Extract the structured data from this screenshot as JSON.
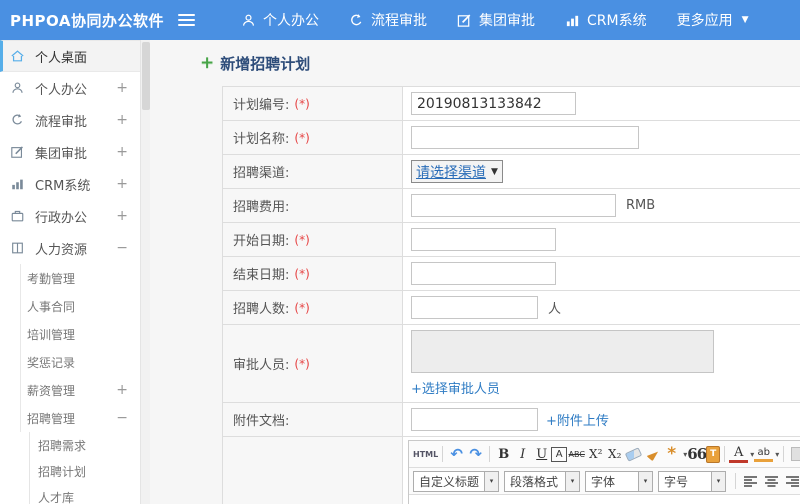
{
  "app": {
    "logo": "PHPOA协同办公软件"
  },
  "colors": {
    "navbar": "#4a90e2",
    "active_accent": "#56aee9",
    "title": "#2e4d7a",
    "plus_green": "#47a447",
    "link": "#2f7cc4",
    "required": "#e64545"
  },
  "navbar": {
    "items": [
      {
        "label": "个人办公",
        "icon": "user-icon"
      },
      {
        "label": "流程审批",
        "icon": "workflow-icon"
      },
      {
        "label": "集团审批",
        "icon": "edit-icon"
      },
      {
        "label": "CRM系统",
        "icon": "chart-icon"
      },
      {
        "label": "更多应用",
        "icon": "caret-down-icon",
        "caret": "▼"
      }
    ]
  },
  "sidebar": {
    "items": [
      {
        "label": "个人桌面",
        "icon": "home-icon",
        "expander": "",
        "active": true
      },
      {
        "label": "个人办公",
        "icon": "user-icon",
        "expander": "+"
      },
      {
        "label": "流程审批",
        "icon": "workflow-icon",
        "expander": "+"
      },
      {
        "label": "集团审批",
        "icon": "edit-icon",
        "expander": "+"
      },
      {
        "label": "CRM系统",
        "icon": "chart-icon",
        "expander": "+"
      },
      {
        "label": "行政办公",
        "icon": "briefcase-icon",
        "expander": "+"
      },
      {
        "label": "人力资源",
        "icon": "book-icon",
        "expander": "−"
      },
      {
        "label": "考勤管理",
        "expander": ""
      },
      {
        "label": "人事合同",
        "expander": ""
      },
      {
        "label": "培训管理",
        "expander": ""
      },
      {
        "label": "奖惩记录",
        "expander": ""
      },
      {
        "label": "薪资管理",
        "expander": "+"
      },
      {
        "label": "招聘管理",
        "expander": "−"
      },
      {
        "label": "招聘需求",
        "expander": ""
      },
      {
        "label": "招聘计划",
        "expander": ""
      },
      {
        "label": "人才库",
        "expander": ""
      }
    ]
  },
  "page": {
    "title": "新增招聘计划",
    "title_icon": "+"
  },
  "form": {
    "rows": [
      {
        "label": "计划编号:",
        "required": "(*)",
        "value": "20190813133842"
      },
      {
        "label": "计划名称:",
        "required": "(*)",
        "value": ""
      },
      {
        "label": "招聘渠道:",
        "required": "",
        "select_value": "请选择渠道",
        "select_caret": "▼"
      },
      {
        "label": "招聘费用:",
        "required": "",
        "suffix": "RMB"
      },
      {
        "label": "开始日期:",
        "required": "(*)"
      },
      {
        "label": "结束日期:",
        "required": "(*)"
      },
      {
        "label": "招聘人数:",
        "required": "(*)",
        "suffix": "人"
      },
      {
        "label": "审批人员:",
        "required": "(*)",
        "link": "+选择审批人员"
      },
      {
        "label": "附件文档:",
        "required": "",
        "link": "+附件上传"
      }
    ]
  },
  "editor": {
    "buttons": {
      "html": "HTML",
      "undo": "↶",
      "redo": "↷",
      "bold": "B",
      "italic": "I",
      "underline": "U",
      "font_border": "A",
      "strikethrough": "ABC",
      "superscript": "X²",
      "subscript": "X₂",
      "quote": "66",
      "paste": "T",
      "sparkle": "*",
      "font_color": "A",
      "highlight": "ab",
      "caret": "▾"
    },
    "selects": [
      {
        "label": "自定义标题"
      },
      {
        "label": "段落格式"
      },
      {
        "label": "字体"
      },
      {
        "label": "字号"
      }
    ]
  }
}
